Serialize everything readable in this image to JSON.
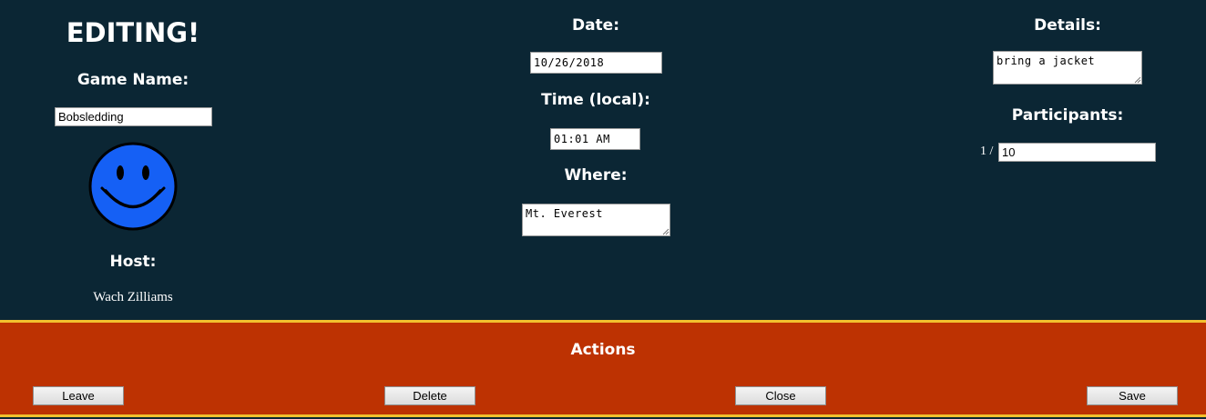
{
  "left": {
    "title": "EDITING!",
    "game_name_label": "Game Name:",
    "game_name_value": "Bobsledding",
    "avatar_icon": "smiley-face-icon",
    "avatar_color": "#1560f5",
    "host_label": "Host:",
    "host_name": "Wach Zilliams"
  },
  "middle": {
    "date_label": "Date:",
    "date_value": "10/26/2018",
    "time_label": "Time (local):",
    "time_value": "01:01 AM",
    "where_label": "Where:",
    "where_value": "Mt. Everest"
  },
  "right": {
    "details_label": "Details:",
    "details_value": "bring a jacket",
    "participants_label": "Participants:",
    "participants_current": "1 /",
    "participants_max": "10"
  },
  "actions": {
    "title": "Actions",
    "leave_label": "Leave",
    "delete_label": "Delete",
    "close_label": "Close",
    "save_label": "Save"
  },
  "colors": {
    "background": "#0b2634",
    "actions_background": "#bd3202",
    "divider": "#f2c12e"
  }
}
